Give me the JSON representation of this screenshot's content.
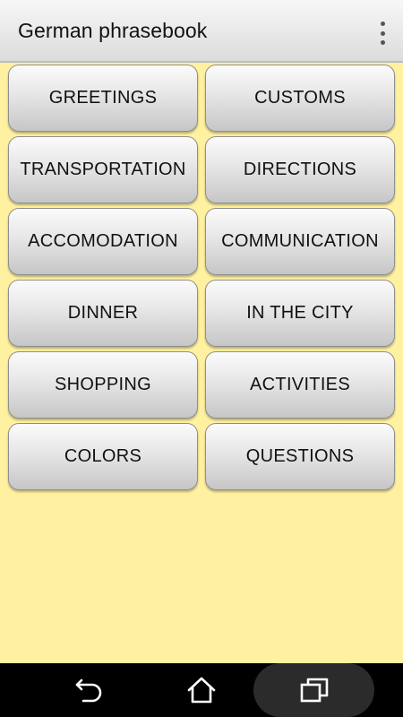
{
  "app_bar": {
    "title": "German phrasebook",
    "overflow_icon": "more-vert-icon"
  },
  "categories": [
    {
      "label": "GREETINGS"
    },
    {
      "label": "CUSTOMS"
    },
    {
      "label": "TRANSPORTATION"
    },
    {
      "label": "DIRECTIONS"
    },
    {
      "label": "ACCOMODATION"
    },
    {
      "label": "COMMUNICATION"
    },
    {
      "label": "DINNER"
    },
    {
      "label": "IN THE CITY"
    },
    {
      "label": "SHOPPING"
    },
    {
      "label": "ACTIVITIES"
    },
    {
      "label": "COLORS"
    },
    {
      "label": "QUESTIONS"
    }
  ],
  "nav_bar": {
    "back_icon": "back-icon",
    "home_icon": "home-icon",
    "recents_icon": "recents-icon"
  },
  "colors": {
    "background": "#FFF1A0",
    "app_bar": "#E6E6E6",
    "nav_bar": "#000000"
  }
}
